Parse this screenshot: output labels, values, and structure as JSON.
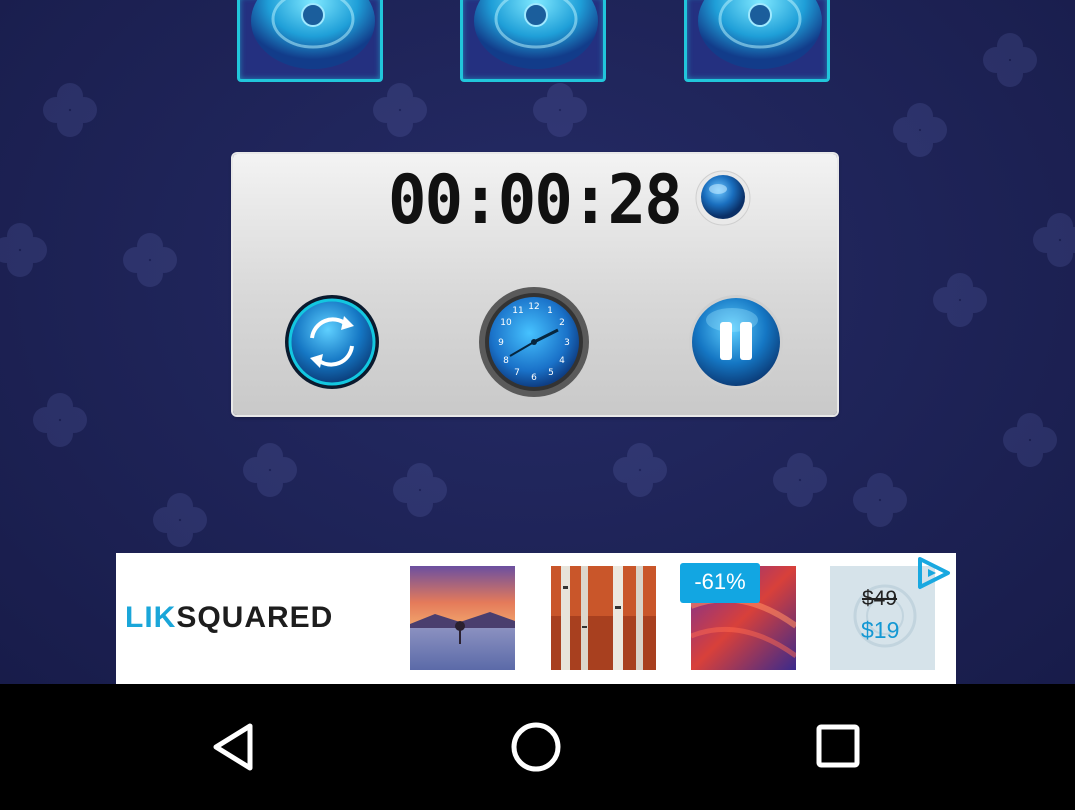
{
  "fans": [
    {
      "label": "fan-1"
    },
    {
      "label": "fan-2"
    },
    {
      "label": "fan-3"
    }
  ],
  "timer": {
    "display": "00:00:28"
  },
  "controls": {
    "reset": "reset-icon",
    "clock": "clock-icon",
    "pause": "pause-icon"
  },
  "ad": {
    "logo_part1": "LIK",
    "logo_part2": "SQUARED",
    "discount": "-61%",
    "price_old": "$49",
    "price_new": "$19",
    "accent_color": "#12a6e2"
  },
  "colors": {
    "background": "#1f2457",
    "tile_border": "#21c6db",
    "panel": "#d8d8d8"
  }
}
